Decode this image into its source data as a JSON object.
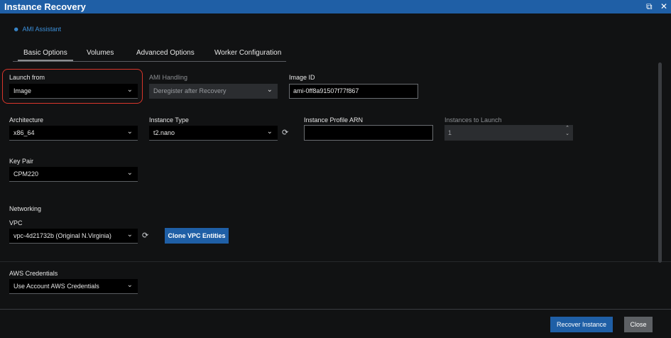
{
  "window": {
    "title": "Instance Recovery",
    "maximize_icon": "maximize-icon",
    "close_icon": "close-icon"
  },
  "ami_assistant": {
    "label": "AMI Assistant",
    "icon": "person-icon"
  },
  "tabs": [
    {
      "label": "Basic Options",
      "active": true
    },
    {
      "label": "Volumes",
      "active": false
    },
    {
      "label": "Advanced Options",
      "active": false
    },
    {
      "label": "Worker Configuration",
      "active": false
    }
  ],
  "fields": {
    "launch_from": {
      "label": "Launch from",
      "value": "Image"
    },
    "ami_handling": {
      "label": "AMI Handling",
      "value": "Deregister after Recovery",
      "disabled": true
    },
    "image_id": {
      "label": "Image ID",
      "value": "ami-0ff8a91507f77f867"
    },
    "architecture": {
      "label": "Architecture",
      "value": "x86_64"
    },
    "instance_type": {
      "label": "Instance Type",
      "value": "t2.nano"
    },
    "instance_profile_arn": {
      "label": "Instance Profile ARN",
      "value": ""
    },
    "instances_to_launch": {
      "label": "Instances to Launch",
      "value": "1",
      "disabled": true
    },
    "key_pair": {
      "label": "Key Pair",
      "value": "CPM220"
    }
  },
  "networking": {
    "heading": "Networking",
    "vpc_label": "VPC",
    "vpc_value": "vpc-4d21732b (Original N.Virginia)",
    "clone_button": "Clone VPC Entities"
  },
  "aws_credentials": {
    "label": "AWS Credentials",
    "value": "Use Account AWS Credentials"
  },
  "footer": {
    "recover_button": "Recover Instance",
    "close_button": "Close"
  },
  "colors": {
    "accent": "#1f5fa6",
    "link": "#3b8fd9",
    "highlight": "#d9362b",
    "background": "#111213"
  }
}
